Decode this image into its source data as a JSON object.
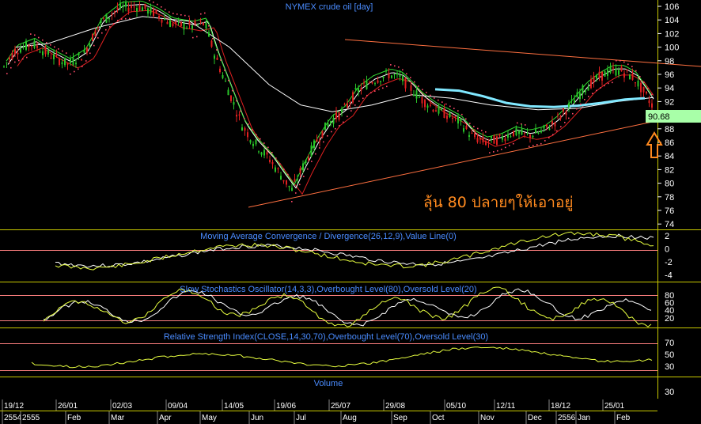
{
  "chart": {
    "title": "NYMEX crude oil [day]",
    "price_axis": {
      "ticks": [
        "106",
        "104",
        "102",
        "100",
        "98",
        "96",
        "94",
        "92",
        "90",
        "88",
        "86",
        "84",
        "82",
        "80",
        "78",
        "76",
        "74"
      ],
      "last_price": "90.68",
      "last_price_color": "#a8ffa8"
    },
    "annotation": {
      "text": "ลุ้น 80 ปลายๆให้เอาอยู่",
      "color": "#ff8a1f"
    },
    "panels": {
      "macd": {
        "title": "Moving Average Convergence / Divergence(26,12,9),Value Line(0)",
        "ticks": [
          "2",
          "0",
          "-2",
          "-4"
        ]
      },
      "stochastics": {
        "title": "Slow Stochastics Oscillator(14,3,3),Overbought Level(80),Oversold Level(20)",
        "ticks": [
          "80",
          "60",
          "40",
          "20"
        ]
      },
      "rsi": {
        "title": "Relative Strength Index(CLOSE,14,30,70),Overbought Level(70),Oversold Level(30)",
        "ticks": [
          "70",
          "50",
          "30"
        ]
      },
      "volume": {
        "title": "Volume",
        "ticks": [
          "30"
        ]
      }
    },
    "x_axis": {
      "dates": [
        "19/12",
        "26/01",
        "02/03",
        "09/04",
        "14/05",
        "19/06",
        "25/07",
        "29/08",
        "05/10",
        "12/11",
        "18/12",
        "25/01"
      ],
      "months": [
        "2554",
        "2555",
        "Feb",
        "Mar",
        "Apr",
        "May",
        "Jun",
        "Jul",
        "Aug",
        "Sep",
        "Oct",
        "Nov",
        "Dec",
        "2556",
        "Jan",
        "Feb"
      ]
    },
    "colors": {
      "background": "#000000",
      "bull_candle": "#29c629",
      "bear_candle": "#e02020",
      "moving_average_fast": "#ffffff",
      "moving_average_red": "#e02020",
      "moving_average_white": "#ffffff",
      "moving_average_cyan": "#80e8ff",
      "parabolic_sar": "#ff4a6a",
      "trendline": "#ff7040",
      "panel_border": "#c8c800",
      "indicator_line": "#e8ff40",
      "signal_line": "#ffffff",
      "level_line": "#ff8080",
      "title_text": "#4a8cff"
    }
  }
}
